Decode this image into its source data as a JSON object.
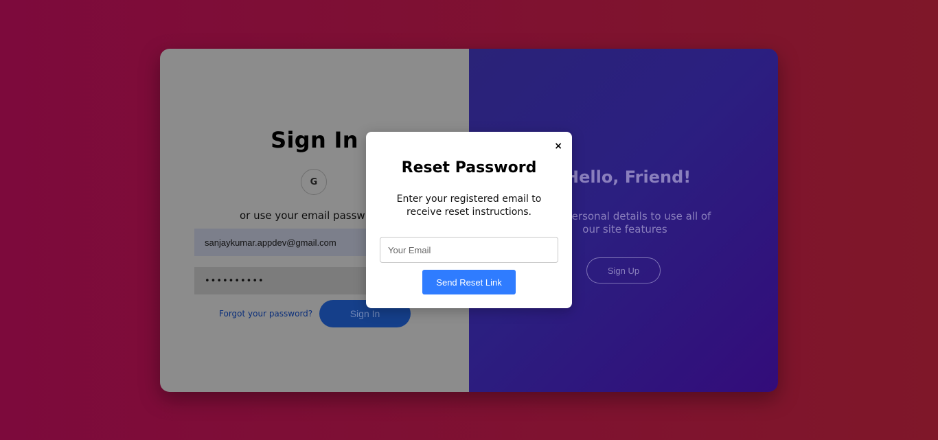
{
  "signin": {
    "title": "Sign In",
    "google_label": "G",
    "or_text": "or use your email passw",
    "email_value": "sanjaykumar.appdev@gmail.com",
    "password_value": "••••••••••",
    "forgot_link": "Forgot your password?",
    "submit_label": "Sign In"
  },
  "welcome": {
    "title": "Hello, Friend!",
    "description": "your personal details to use all of our site features",
    "signup_label": "Sign Up"
  },
  "reset_modal": {
    "close_label": "×",
    "title": "Reset Password",
    "description": "Enter your registered email to receive reset instructions.",
    "email_placeholder": "Your Email",
    "send_label": "Send Reset Link"
  },
  "colors": {
    "background": "#7d0a3c",
    "right_panel": "#2b1f80",
    "accent": "#2f7cff"
  }
}
